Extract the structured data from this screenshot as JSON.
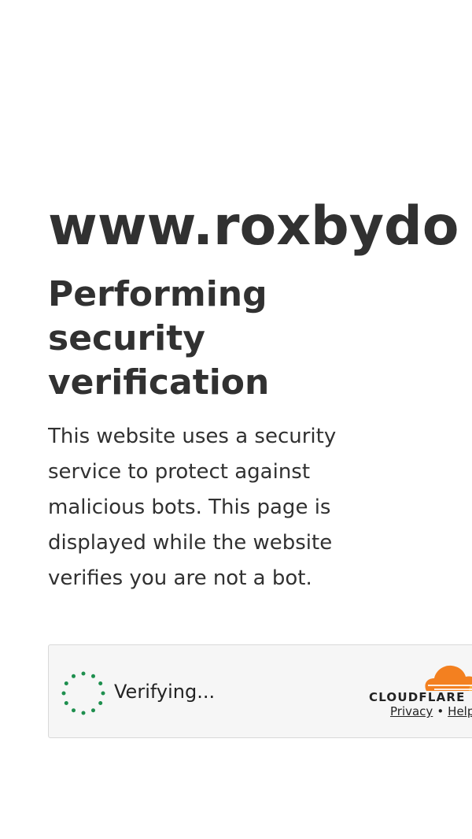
{
  "site": {
    "domain": "www.roxbydo"
  },
  "challenge": {
    "heading": "Performing security verification",
    "description": "This website uses a security service to protect against malicious bots. This page is displayed while the website verifies you are not a bot."
  },
  "widget": {
    "status_text": "Verifying...",
    "brand": "CLOUDFLARE",
    "privacy_label": "Privacy",
    "separator": "•",
    "help_label": "Help",
    "spinner_icon": "loading-spinner-icon",
    "logo_icon": "cloudflare-cloud-icon"
  },
  "colors": {
    "text": "#313131",
    "widget_bg": "#f6f6f6",
    "widget_border": "#d9d9d9",
    "spinner": "#1e8f4e",
    "cloudflare_orange": "#f38020",
    "cloudflare_orange_light": "#faae40"
  }
}
